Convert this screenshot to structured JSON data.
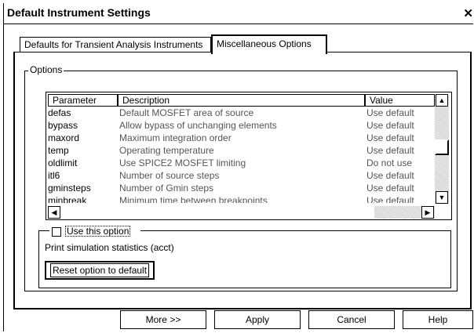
{
  "window": {
    "title": "Default Instrument Settings",
    "close_glyph": "✕"
  },
  "tabs": [
    {
      "label": "Defaults for Transient Analysis Instruments"
    },
    {
      "label": "Miscellaneous Options"
    }
  ],
  "options_group": {
    "label": "Options"
  },
  "table": {
    "headers": [
      "Parameter",
      "Description",
      "Value"
    ],
    "rows": [
      {
        "param": "defas",
        "desc": "Default MOSFET area of source",
        "value": "Use default"
      },
      {
        "param": "bypass",
        "desc": "Allow bypass of unchanging elements",
        "value": "Use default"
      },
      {
        "param": "maxord",
        "desc": "Maximum integration order",
        "value": "Use default"
      },
      {
        "param": "temp",
        "desc": "Operating temperature",
        "value": "Use default"
      },
      {
        "param": "oldlimit",
        "desc": "Use SPICE2 MOSFET limiting",
        "value": "Do not use"
      },
      {
        "param": "itl6",
        "desc": "Number of source steps",
        "value": "Use default"
      },
      {
        "param": "gminsteps",
        "desc": "Number of Gmin steps",
        "value": "Use default"
      },
      {
        "param": "minbreak",
        "desc": "Minimum time between breakpoints",
        "value": "Use default"
      }
    ]
  },
  "use_option": {
    "label": "Use this option",
    "checked": false
  },
  "option_description": "Print simulation statistics (acct)",
  "reset_button": {
    "label": "Reset option to default"
  },
  "buttons": {
    "more": "More >>",
    "apply": "Apply",
    "cancel": "Cancel",
    "help": "Help"
  },
  "icons": {
    "close": "close-icon",
    "scroll_up": "arrow-up-icon",
    "scroll_down": "arrow-down-icon",
    "scroll_left": "arrow-left-icon",
    "scroll_right": "arrow-right-icon"
  }
}
